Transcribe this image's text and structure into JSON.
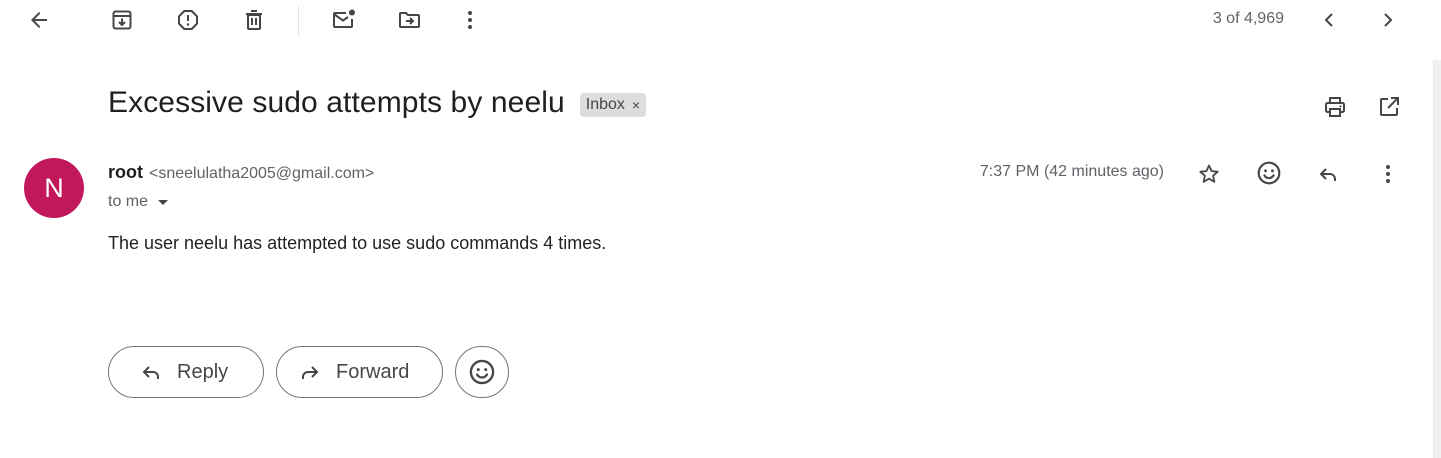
{
  "toolbar": {
    "back": {
      "icon": "arrow-left-icon"
    },
    "archive": {
      "icon": "archive-icon"
    },
    "report_spam": {
      "icon": "report-spam-icon"
    },
    "delete": {
      "icon": "trash-icon"
    },
    "mark_unread": {
      "icon": "mark-unread-icon"
    },
    "move_to": {
      "icon": "move-to-icon"
    },
    "more": {
      "icon": "more-vertical-icon"
    },
    "pager_text": "3 of 4,969",
    "newer": {
      "icon": "chevron-left-icon"
    },
    "older": {
      "icon": "chevron-right-icon"
    }
  },
  "subject": {
    "title": "Excessive sudo attempts by neelu",
    "label": "Inbox",
    "label_remove": "×",
    "print": {
      "icon": "print-icon"
    },
    "open_new_window": {
      "icon": "open-in-new-icon"
    }
  },
  "sender": {
    "avatar_initial": "N",
    "avatar_color": "#c2185b",
    "name": "root",
    "email": "<sneelulatha2005@gmail.com>",
    "to": "to me",
    "timestamp": "7:37 PM (42 minutes ago)",
    "actions": [
      "star-icon",
      "emoji-reaction-icon",
      "reply-icon",
      "more-vertical-icon"
    ]
  },
  "message": {
    "body": "The user neelu has attempted to use sudo commands 4 times."
  },
  "bottom_actions": {
    "reply_label": "Reply",
    "forward_label": "Forward",
    "emoji": {
      "icon": "emoji-reaction-icon"
    }
  },
  "colors": {
    "icon": "#444746",
    "muted_text": "#5f6368",
    "label_chip_bg": "#dddddd",
    "pill_border": "#747775"
  }
}
